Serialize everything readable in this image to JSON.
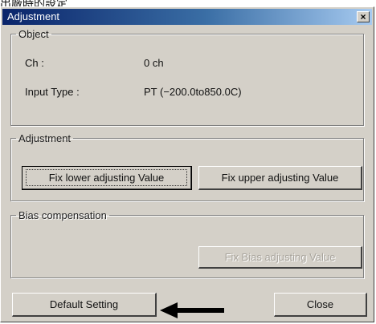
{
  "page_caption": "出廠時的設定",
  "window": {
    "title": "Adjustment",
    "close_glyph": "×"
  },
  "object_group": {
    "legend": "Object",
    "ch_label": "Ch :",
    "ch_value": "0 ch",
    "input_type_label": "Input Type :",
    "input_type_value": "PT (−200.0to850.0C)"
  },
  "adjustment_group": {
    "legend": "Adjustment",
    "fix_lower_label": "Fix lower adjusting Value",
    "fix_upper_label": "Fix upper adjusting Value"
  },
  "bias_group": {
    "legend": "Bias compensation",
    "fix_bias_label": "Fix Bias adjusting Value"
  },
  "footer": {
    "default_setting_label": "Default Setting",
    "close_label": "Close"
  },
  "colors": {
    "dialog_face": "#d4d0c8",
    "titlebar_start": "#0a246a",
    "titlebar_end": "#a6caf0",
    "arrow": "#000000"
  },
  "icons": {
    "close": "close-icon",
    "annotation": "arrow-left-icon"
  }
}
